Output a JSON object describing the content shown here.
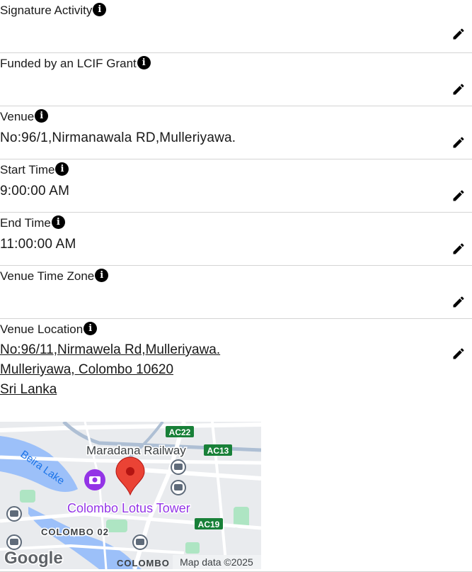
{
  "fields": [
    {
      "label": "Signature Activity",
      "value": ""
    },
    {
      "label": "Funded by an LCIF Grant",
      "value": ""
    },
    {
      "label": "Venue",
      "value": "No:96/1,Nirmanawala RD,Mulleriyawa."
    },
    {
      "label": "Start Time",
      "value": "9:00:00 AM"
    },
    {
      "label": "End Time",
      "value": "11:00:00 AM"
    },
    {
      "label": "Venue Time Zone",
      "value": ""
    }
  ],
  "location": {
    "label": "Venue Location",
    "line1": "No:96/11,Nirmawela Rd,Mulleriyawa.",
    "line2": "Mulleriyawa, Colombo 10620",
    "line3": "Sri Lanka"
  },
  "map": {
    "place_railway": "Maradana Railway",
    "place_tower": "Colombo Lotus Tower",
    "lake": "Beira Lake",
    "area1": "COLOMBO 02",
    "area2": "COLOMBO",
    "road1": "AC22",
    "road2": "AC13",
    "road3": "AC19",
    "logo": "Google",
    "attribution": "Map data ©2025"
  },
  "icons": {
    "info": "info-icon",
    "edit": "pencil-edit-icon",
    "pin": "map-pin-icon"
  },
  "colors": {
    "lake": "#9cc0f9",
    "park": "#aee5c3",
    "road_label": "#188038",
    "poi_purple": "#9334e6",
    "pin": "#ea4335"
  }
}
